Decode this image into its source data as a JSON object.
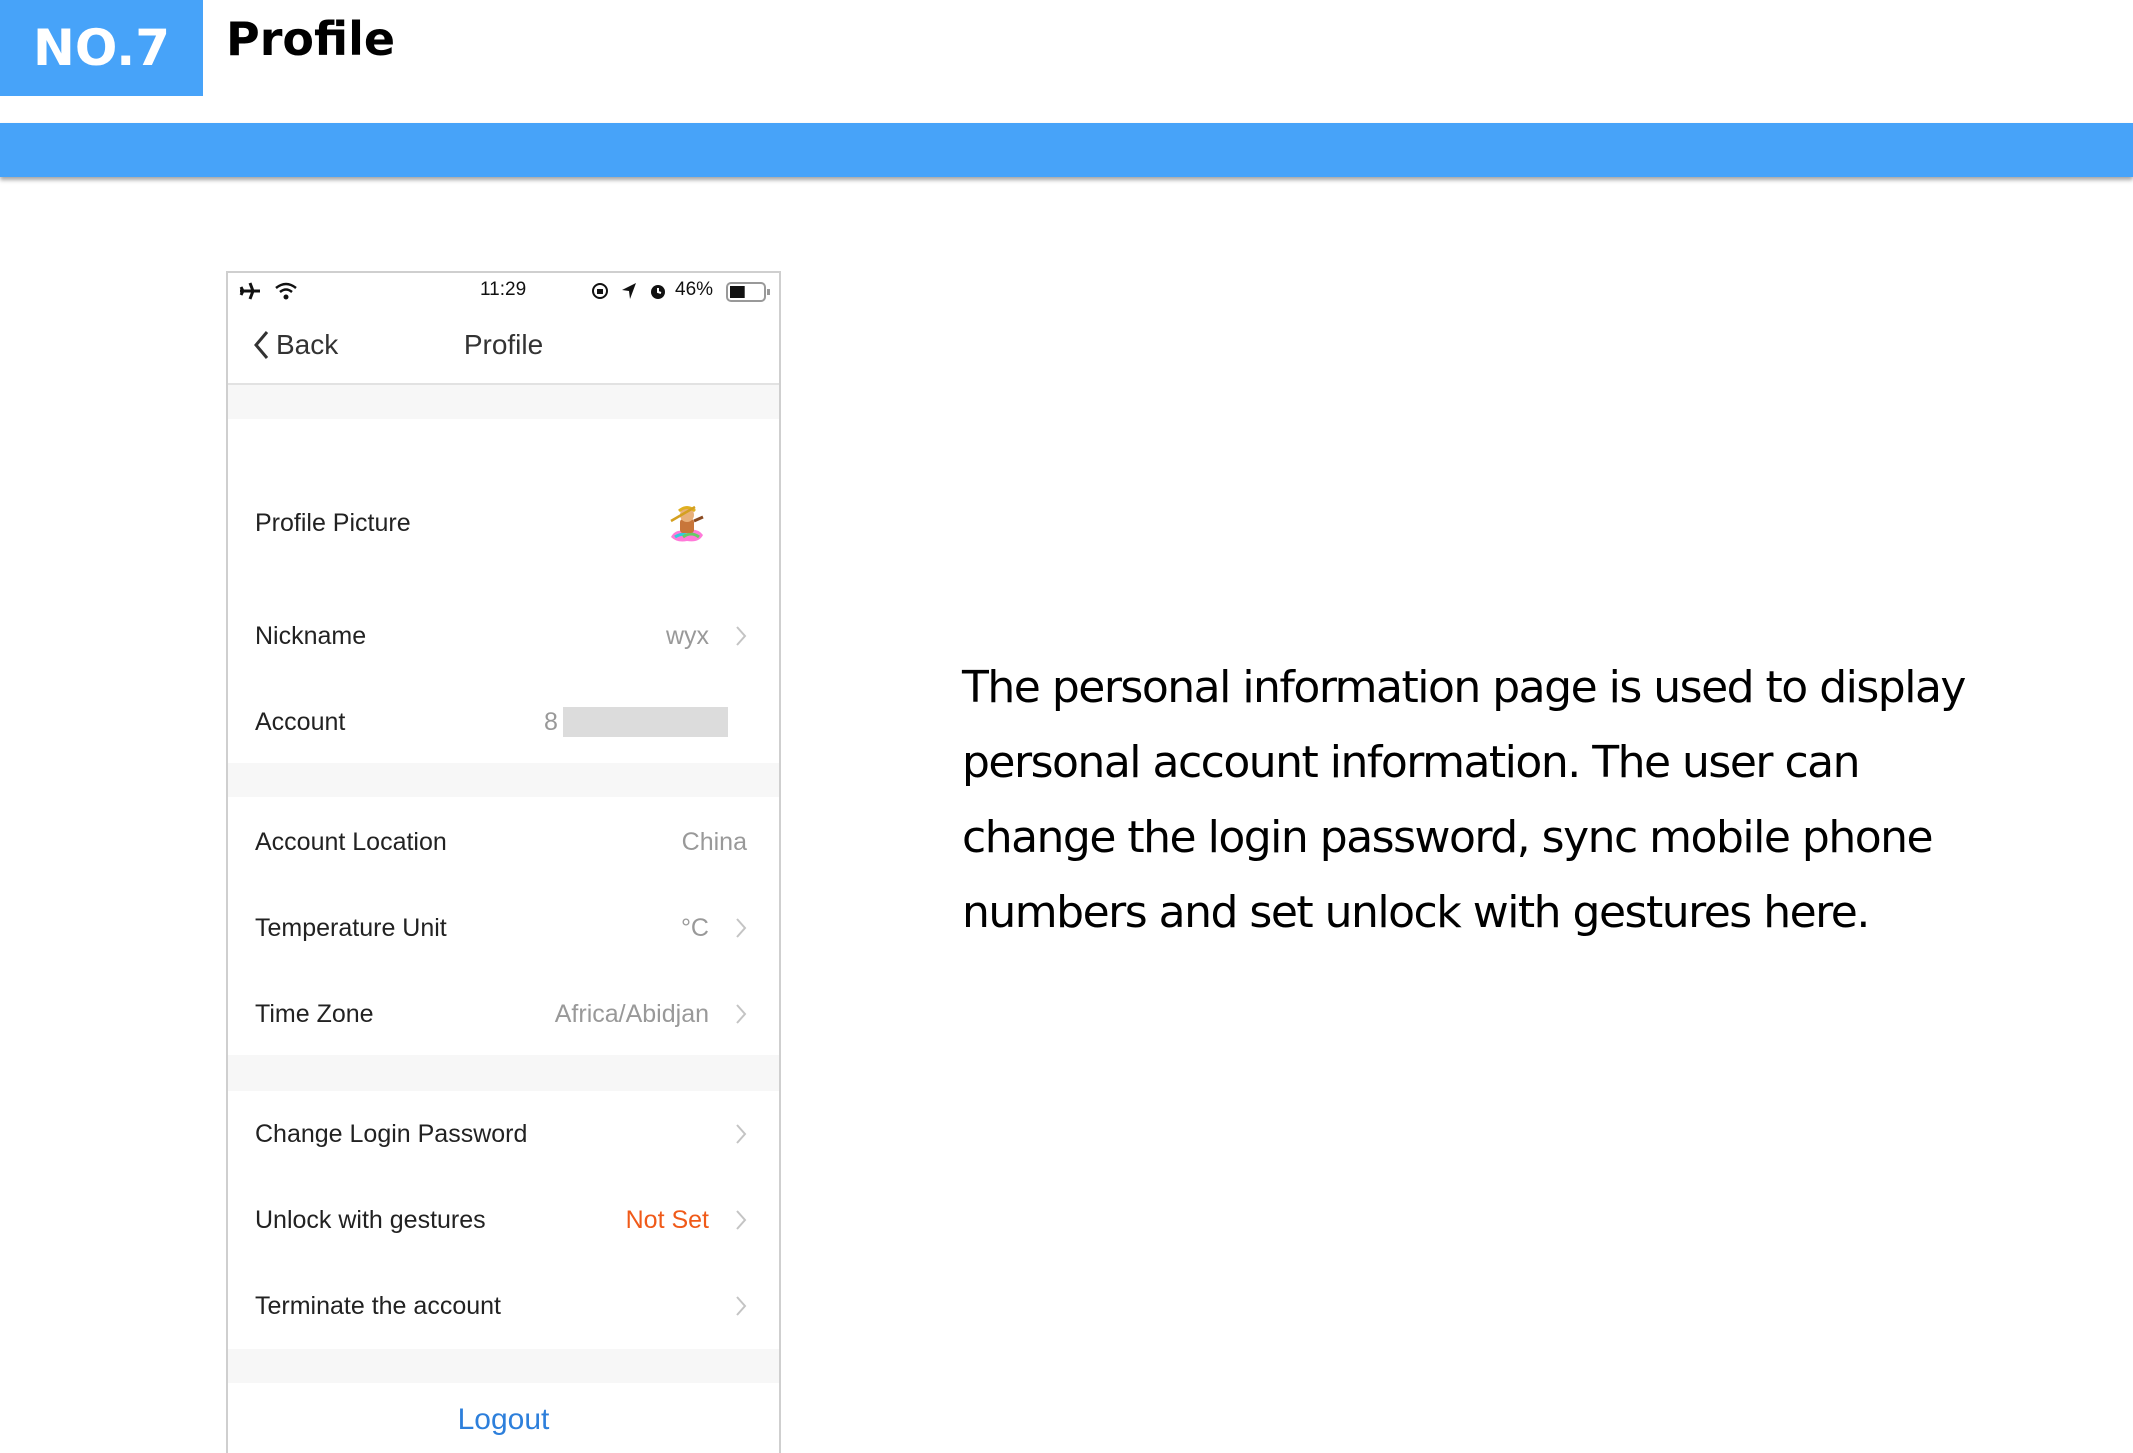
{
  "header": {
    "badge": "NO.7",
    "title": "Profile",
    "accent_color": "#47a3f9"
  },
  "phone": {
    "status_bar": {
      "icons_left": [
        "airplane-mode-icon",
        "wifi-icon"
      ],
      "time": "11:29",
      "icons_right": [
        "rotation-lock-icon",
        "location-icon",
        "alarm-icon"
      ],
      "battery_percent": "46%",
      "battery_level": 0.46
    },
    "nav": {
      "back_label": "Back",
      "title": "Profile"
    },
    "rows": [
      {
        "label": "Profile Picture",
        "value": "",
        "chevron": false,
        "avatar": true
      },
      {
        "label": "Nickname",
        "value": "wyx",
        "chevron": true
      },
      {
        "label": "Account",
        "value": "8",
        "chevron": false,
        "redacted": true
      },
      {
        "label": "Account Location",
        "value": "China",
        "chevron": false
      },
      {
        "label": "Temperature Unit",
        "value": "°C",
        "chevron": true
      },
      {
        "label": "Time Zone",
        "value": "Africa/Abidjan",
        "chevron": true
      },
      {
        "label": "Change Login Password",
        "value": "",
        "chevron": true
      },
      {
        "label": "Unlock with gestures",
        "value": "Not Set",
        "chevron": true,
        "value_color": "#f05a19"
      },
      {
        "label": "Terminate the account",
        "value": "",
        "chevron": true
      }
    ],
    "logout_label": "Logout",
    "logout_color": "#2d7fdb"
  },
  "description": "The personal information page is used to display personal account information. The user can change the login password, sync mobile phone numbers and set unlock with gestures here."
}
